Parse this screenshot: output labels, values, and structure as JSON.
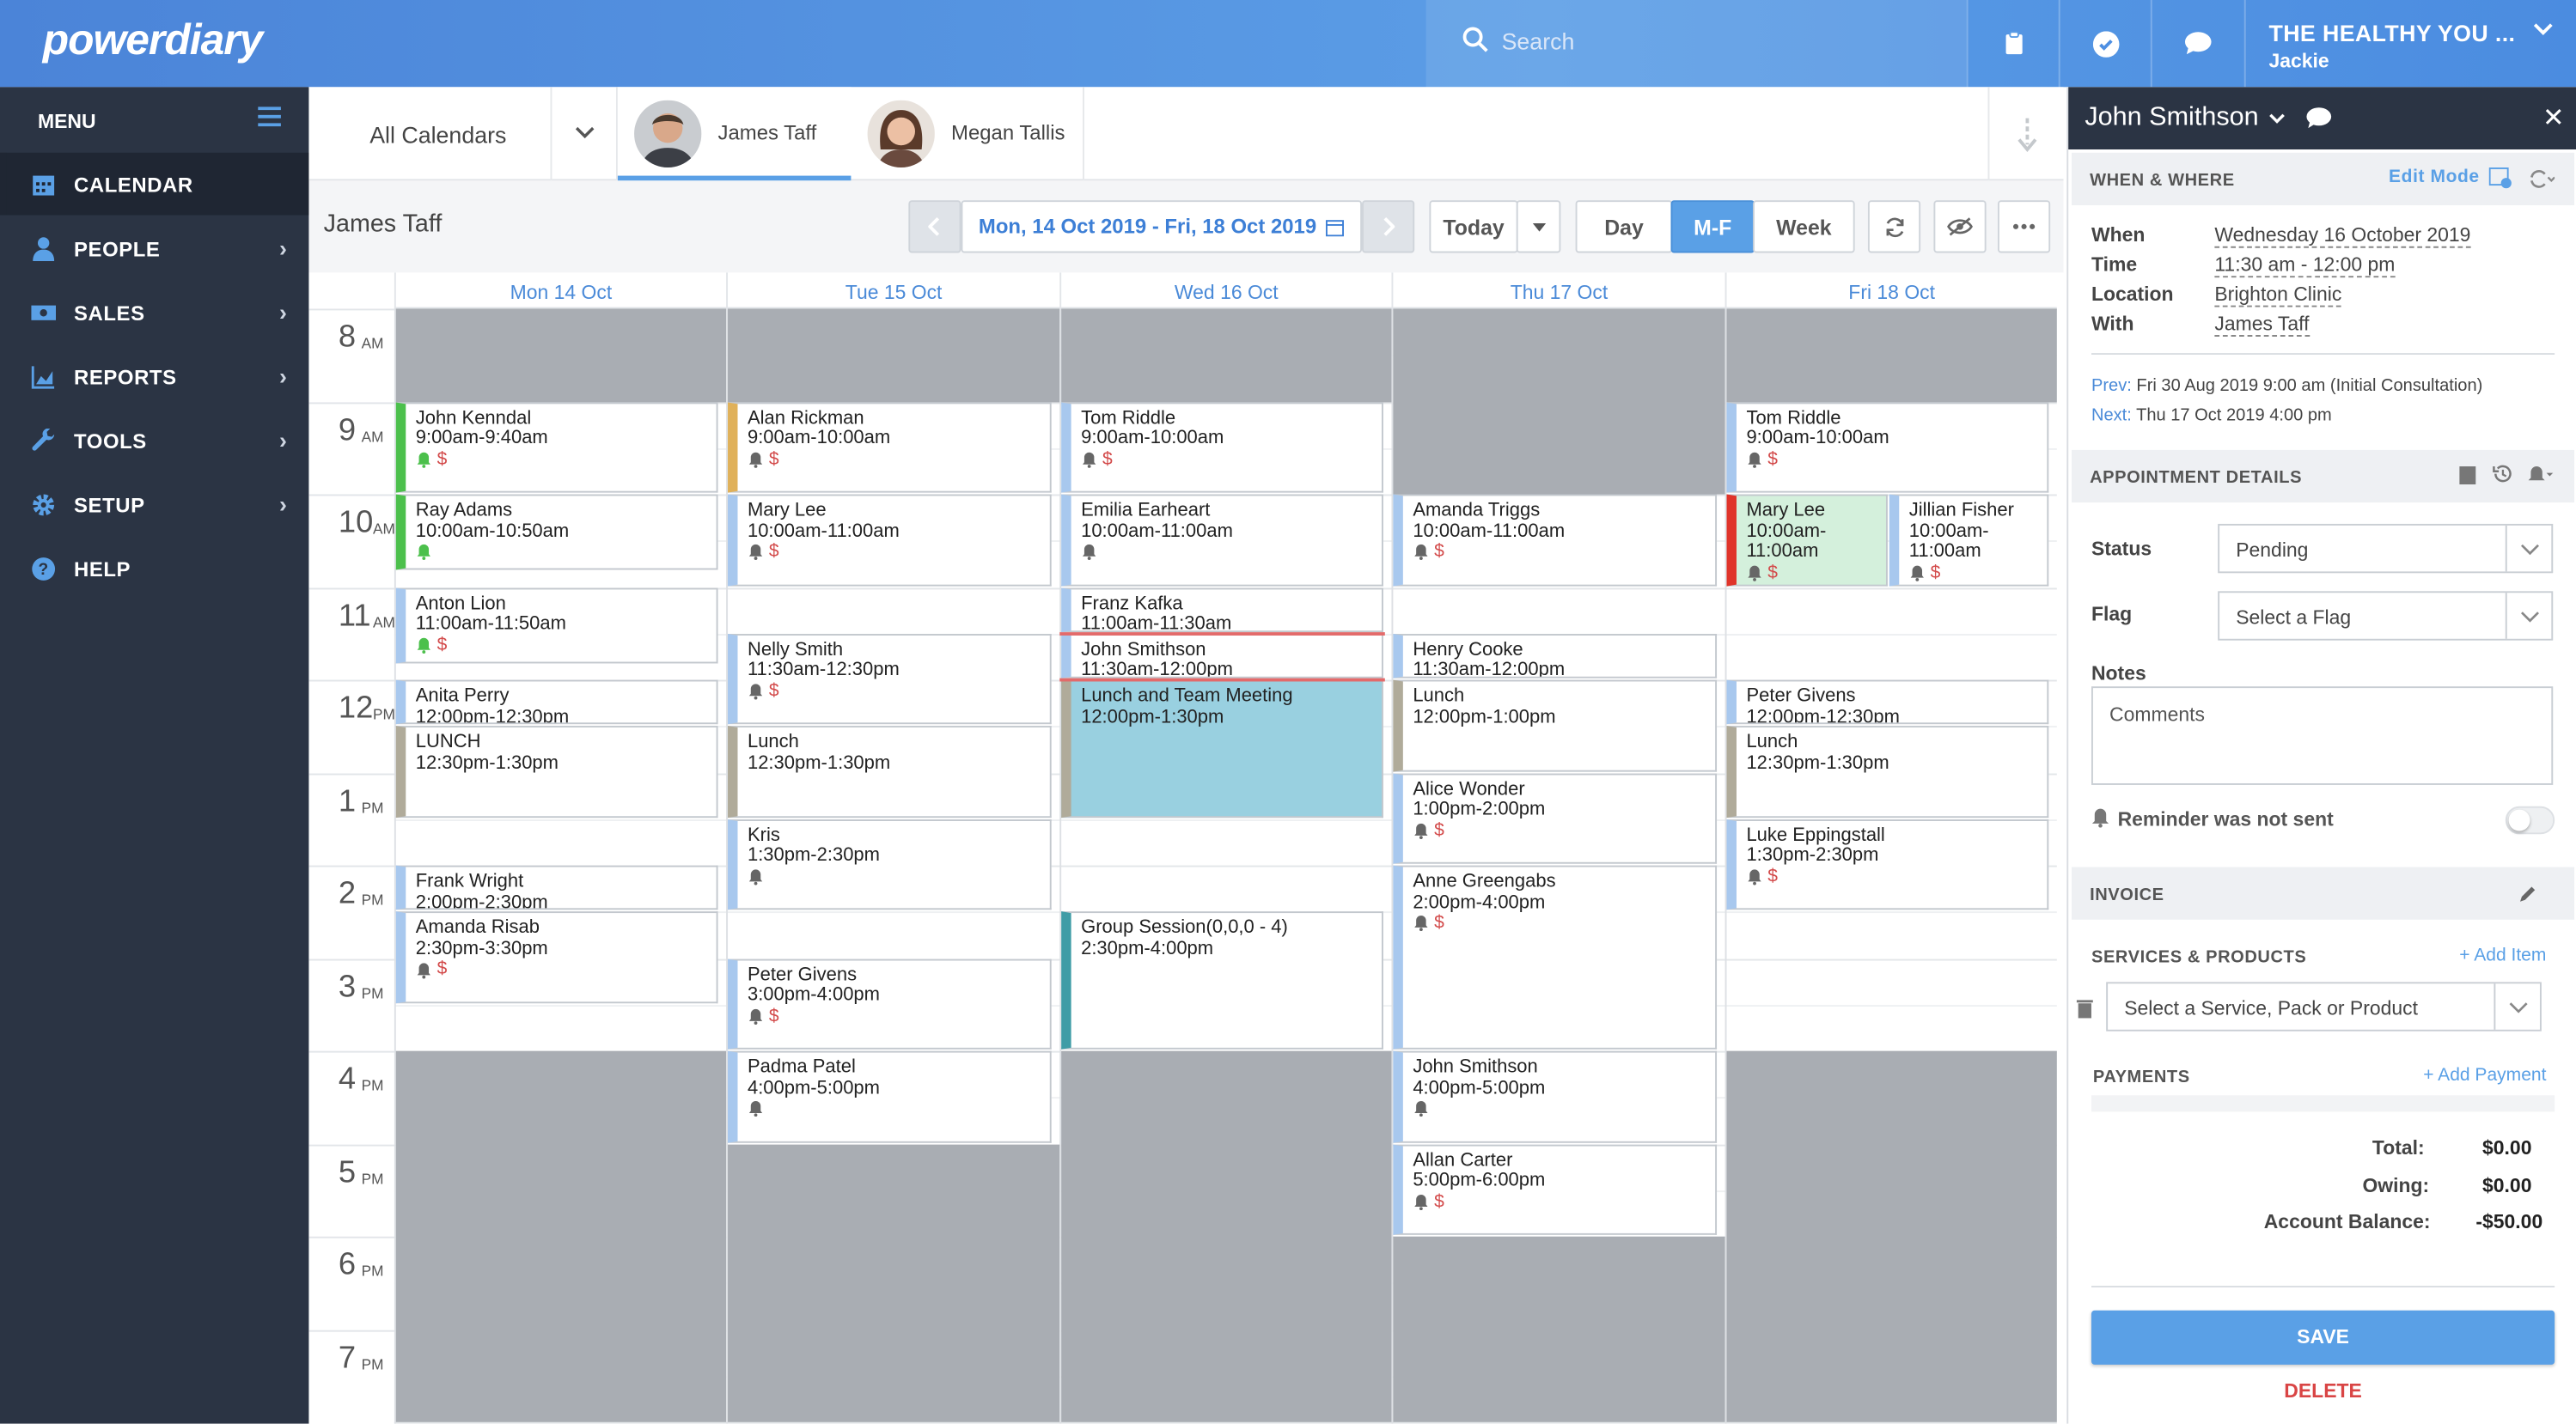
{
  "app": {
    "logo": "powerdiary",
    "search_placeholder": "Search",
    "account_name": "THE HEALTHY YOU ...",
    "account_user": "Jackie"
  },
  "sidebar": {
    "menu_label": "MENU",
    "items": [
      {
        "label": "CALENDAR",
        "icon": "calendar-icon",
        "active": true,
        "arrow": false
      },
      {
        "label": "PEOPLE",
        "icon": "person-icon",
        "active": false,
        "arrow": true
      },
      {
        "label": "SALES",
        "icon": "cash-icon",
        "active": false,
        "arrow": true
      },
      {
        "label": "REPORTS",
        "icon": "chart-icon",
        "active": false,
        "arrow": true
      },
      {
        "label": "TOOLS",
        "icon": "wrench-icon",
        "active": false,
        "arrow": true
      },
      {
        "label": "SETUP",
        "icon": "gear-icon",
        "active": false,
        "arrow": true
      },
      {
        "label": "HELP",
        "icon": "help-icon",
        "active": false,
        "arrow": false
      }
    ]
  },
  "tabs": {
    "all_calendars": "All Calendars",
    "practitioners": [
      "James Taff",
      "Megan Tallis"
    ]
  },
  "toolbar": {
    "calendar_owner": "James Taff",
    "date_range": "Mon, 14 Oct 2019 - Fri, 18 Oct 2019",
    "today": "Today",
    "views": [
      "Day",
      "M-F",
      "Week"
    ],
    "active_view": "M-F"
  },
  "calendar": {
    "days": [
      "Mon 14 Oct",
      "Tue 15 Oct",
      "Wed 16 Oct",
      "Thu 17 Oct",
      "Fri 18 Oct"
    ],
    "hours": [
      {
        "h": "8",
        "ap": "AM"
      },
      {
        "h": "9",
        "ap": "AM"
      },
      {
        "h": "10",
        "ap": "AM"
      },
      {
        "h": "11",
        "ap": "AM"
      },
      {
        "h": "12",
        "ap": "PM"
      },
      {
        "h": "1",
        "ap": "PM"
      },
      {
        "h": "2",
        "ap": "PM"
      },
      {
        "h": "3",
        "ap": "PM"
      },
      {
        "h": "4",
        "ap": "PM"
      },
      {
        "h": "5",
        "ap": "PM"
      },
      {
        "h": "6",
        "ap": "PM"
      },
      {
        "h": "7",
        "ap": "PM"
      }
    ],
    "events": [
      {
        "day": 0,
        "name": "John Kenndal",
        "time": "9:00am-9:40am",
        "start": 9.0,
        "end": 10.0,
        "color": "#4cc04c",
        "bell": true,
        "bell_color": "#4cc04c",
        "dollar": true
      },
      {
        "day": 0,
        "name": "Ray Adams",
        "time": "10:00am-10:50am",
        "start": 10.0,
        "end": 10.833,
        "color": "#4cc04c",
        "bell": true,
        "bell_color": "#4cc04c",
        "dollar": false
      },
      {
        "day": 0,
        "name": "Anton Lion",
        "time": "11:00am-11:50am",
        "start": 11.0,
        "end": 11.833,
        "color": "#a8c8ee",
        "bell": true,
        "bell_color": "#4cc04c",
        "dollar": true
      },
      {
        "day": 0,
        "name": "Anita Perry",
        "time": "12:00pm-12:30pm",
        "start": 12.0,
        "end": 12.5,
        "color": "#a8c8ee",
        "bell": false,
        "dollar": false
      },
      {
        "day": 0,
        "name": "LUNCH",
        "time": "12:30pm-1:30pm",
        "start": 12.5,
        "end": 13.5,
        "color": "#b0ab9a",
        "bell": false,
        "dollar": false
      },
      {
        "day": 0,
        "name": "Frank Wright",
        "time": "2:00pm-2:30pm",
        "start": 14.0,
        "end": 14.5,
        "color": "#a8c8ee",
        "bell": false,
        "dollar": false
      },
      {
        "day": 0,
        "name": "Amanda Risab",
        "time": "2:30pm-3:30pm",
        "start": 14.5,
        "end": 15.5,
        "color": "#a8c8ee",
        "bell": true,
        "dollar": true
      },
      {
        "day": 1,
        "name": "Alan Rickman",
        "time": "9:00am-10:00am",
        "start": 9.0,
        "end": 10.0,
        "color": "#e0b15a",
        "bell": true,
        "dollar": true
      },
      {
        "day": 1,
        "name": "Mary Lee",
        "time": "10:00am-11:00am",
        "start": 10.0,
        "end": 11.0,
        "color": "#a8c8ee",
        "bell": true,
        "dollar": true
      },
      {
        "day": 1,
        "name": "Nelly Smith",
        "time": "11:30am-12:30pm",
        "start": 11.5,
        "end": 12.5,
        "color": "#a8c8ee",
        "bell": true,
        "dollar": true
      },
      {
        "day": 1,
        "name": "Lunch",
        "time": "12:30pm-1:30pm",
        "start": 12.5,
        "end": 13.5,
        "color": "#b0ab9a",
        "bell": false,
        "dollar": false
      },
      {
        "day": 1,
        "name": "Kris",
        "time": "1:30pm-2:30pm",
        "start": 13.5,
        "end": 14.5,
        "color": "#a8c8ee",
        "bell": true,
        "dollar": false
      },
      {
        "day": 1,
        "name": "Peter Givens",
        "time": "3:00pm-4:00pm",
        "start": 15.0,
        "end": 16.0,
        "color": "#a8c8ee",
        "bell": true,
        "dollar": true
      },
      {
        "day": 1,
        "name": "Padma Patel",
        "time": "4:00pm-5:00pm",
        "start": 16.0,
        "end": 17.0,
        "color": "#a8c8ee",
        "bell": true,
        "dollar": false
      },
      {
        "day": 2,
        "name": "Tom Riddle",
        "time": "9:00am-10:00am",
        "start": 9.0,
        "end": 10.0,
        "color": "#a8c8ee",
        "bell": true,
        "dollar": true
      },
      {
        "day": 2,
        "name": "Emilia Earheart",
        "time": "10:00am-11:00am",
        "start": 10.0,
        "end": 11.0,
        "color": "#a8c8ee",
        "bell": true,
        "dollar": false
      },
      {
        "day": 2,
        "name": "Franz Kafka",
        "time": "11:00am-11:30am",
        "start": 11.0,
        "end": 11.5,
        "color": "#a8c8ee",
        "bell": false,
        "dollar": false
      },
      {
        "day": 2,
        "name": "John Smithson",
        "time": "11:30am-12:00pm",
        "start": 11.5,
        "end": 12.0,
        "color": "#a8c8ee",
        "bell": false,
        "dollar": false
      },
      {
        "day": 2,
        "name": "Lunch and Team Meeting",
        "time": "12:00pm-1:30pm",
        "start": 12.0,
        "end": 13.5,
        "color": "#b0ab9a",
        "bell": false,
        "dollar": false,
        "fill": "#99d0e0"
      },
      {
        "day": 2,
        "name": "Group Session(0,0,0 - 4)",
        "time": "2:30pm-4:00pm",
        "start": 14.5,
        "end": 16.0,
        "color": "#3f9ca6",
        "bell": false,
        "dollar": false
      },
      {
        "day": 3,
        "name": "Amanda Triggs",
        "time": "10:00am-11:00am",
        "start": 10.0,
        "end": 11.0,
        "color": "#a8c8ee",
        "bell": true,
        "dollar": true
      },
      {
        "day": 3,
        "name": "Henry Cooke",
        "time": "11:30am-12:00pm",
        "start": 11.5,
        "end": 12.0,
        "color": "#a8c8ee",
        "bell": false,
        "dollar": false
      },
      {
        "day": 3,
        "name": "Lunch",
        "time": "12:00pm-1:00pm",
        "start": 12.0,
        "end": 13.0,
        "color": "#b0ab9a",
        "bell": false,
        "dollar": false
      },
      {
        "day": 3,
        "name": "Alice Wonder",
        "time": "1:00pm-2:00pm",
        "start": 13.0,
        "end": 14.0,
        "color": "#a8c8ee",
        "bell": true,
        "dollar": true
      },
      {
        "day": 3,
        "name": "Anne Greengabs",
        "time": "2:00pm-4:00pm",
        "start": 14.0,
        "end": 16.0,
        "color": "#a8c8ee",
        "bell": true,
        "dollar": true
      },
      {
        "day": 3,
        "name": "John Smithson",
        "time": "4:00pm-5:00pm",
        "start": 16.0,
        "end": 17.0,
        "color": "#a8c8ee",
        "bell": true,
        "dollar": false
      },
      {
        "day": 3,
        "name": "Allan Carter",
        "time": "5:00pm-6:00pm",
        "start": 17.0,
        "end": 18.0,
        "color": "#a8c8ee",
        "bell": true,
        "dollar": true
      },
      {
        "day": 4,
        "name": "Tom Riddle",
        "time": "9:00am-10:00am",
        "start": 9.0,
        "end": 10.0,
        "color": "#a8c8ee",
        "bell": true,
        "dollar": true
      },
      {
        "day": 4,
        "name": "Mary Lee",
        "time": "10:00am-11:00am",
        "start": 10.0,
        "end": 11.0,
        "color": "#e0342a",
        "bell": true,
        "dollar": true,
        "fill": "#d4f0dc",
        "half": "left"
      },
      {
        "day": 4,
        "name": "Jillian Fisher",
        "time": "10:00am-11:00am",
        "start": 10.0,
        "end": 11.0,
        "color": "#a8c8ee",
        "bell": true,
        "dollar": true,
        "half": "right"
      },
      {
        "day": 4,
        "name": "Peter Givens",
        "time": "12:00pm-12:30pm",
        "start": 12.0,
        "end": 12.5,
        "color": "#a8c8ee",
        "bell": false,
        "dollar": false
      },
      {
        "day": 4,
        "name": "Lunch",
        "time": "12:30pm-1:30pm",
        "start": 12.5,
        "end": 13.5,
        "color": "#b0ab9a",
        "bell": false,
        "dollar": false
      },
      {
        "day": 4,
        "name": "Luke Eppingstall",
        "time": "1:30pm-2:30pm",
        "start": 13.5,
        "end": 14.5,
        "color": "#a8c8ee",
        "bell": true,
        "dollar": true
      }
    ],
    "unavailable": [
      {
        "day": 0,
        "ranges": [
          [
            8,
            9
          ],
          [
            16,
            20
          ]
        ]
      },
      {
        "day": 1,
        "ranges": [
          [
            8,
            9
          ],
          [
            17,
            20
          ]
        ]
      },
      {
        "day": 2,
        "ranges": [
          [
            8,
            9
          ],
          [
            16,
            20
          ]
        ]
      },
      {
        "day": 3,
        "ranges": [
          [
            8,
            10
          ],
          [
            18,
            20
          ]
        ]
      },
      {
        "day": 4,
        "ranges": [
          [
            8,
            9
          ],
          [
            16,
            20
          ]
        ]
      }
    ]
  },
  "panel": {
    "client_name": "John Smithson",
    "when_where": "WHEN & WHERE",
    "edit_mode": "Edit Mode",
    "fields": [
      {
        "label": "When",
        "value": "Wednesday 16 October 2019"
      },
      {
        "label": "Time",
        "value": "11:30 am - 12:00 pm"
      },
      {
        "label": "Location",
        "value": "Brighton Clinic"
      },
      {
        "label": "With",
        "value": "James Taff"
      }
    ],
    "prev_label": "Prev:",
    "prev_value": "Fri 30 Aug 2019 9:00 am (Initial Consultation)",
    "next_label": "Next:",
    "next_value": "Thu 17 Oct 2019 4:00 pm",
    "appt_details": "APPOINTMENT DETAILS",
    "status_label": "Status",
    "status_value": "Pending",
    "flag_label": "Flag",
    "flag_value": "Select a Flag",
    "notes_label": "Notes",
    "notes_placeholder": "Comments",
    "reminder": "Reminder was not sent",
    "invoice": "INVOICE",
    "services_label": "SERVICES & PRODUCTS",
    "add_item": "+ Add Item",
    "service_placeholder": "Select a Service, Pack or Product",
    "payments_label": "PAYMENTS",
    "add_payment": "+ Add Payment",
    "totals": [
      {
        "label": "Total:",
        "value": "$0.00"
      },
      {
        "label": "Owing:",
        "value": "$0.00"
      },
      {
        "label": "Account Balance:",
        "value": "-$50.00"
      }
    ],
    "save": "SAVE",
    "delete": "DELETE"
  }
}
